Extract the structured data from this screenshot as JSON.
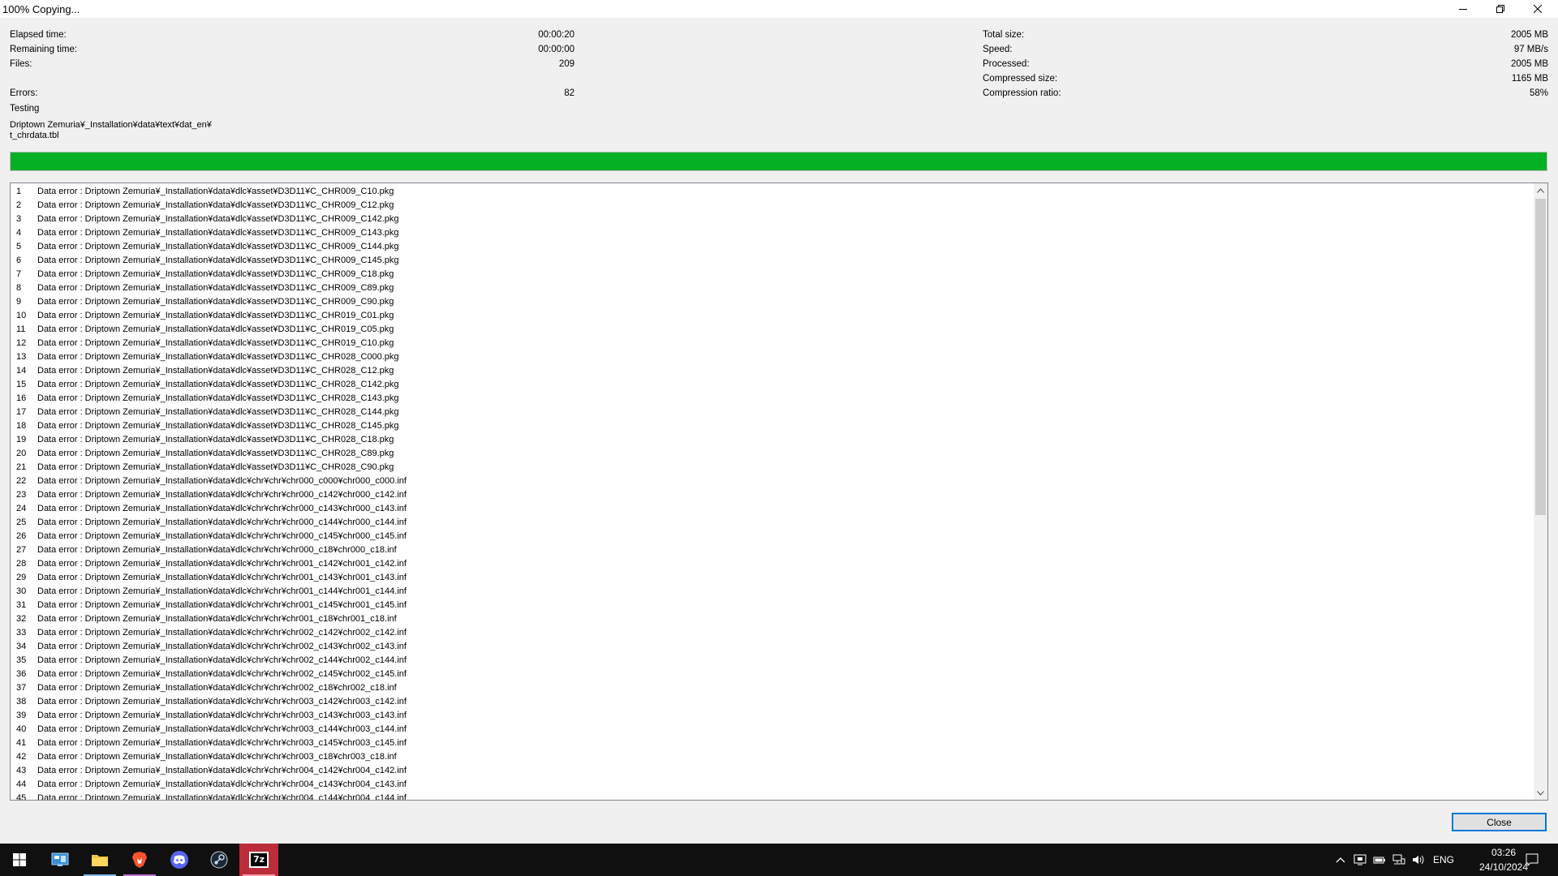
{
  "window": {
    "title": "100% Copying..."
  },
  "stats_left": [
    {
      "label": "Elapsed time:",
      "value": "00:00:20"
    },
    {
      "label": "Remaining time:",
      "value": "00:00:00"
    },
    {
      "label": "Files:",
      "value": "209"
    },
    {
      "label": "Errors:",
      "value": "82"
    }
  ],
  "stats_right": [
    {
      "label": "Total size:",
      "value": "2005 MB"
    },
    {
      "label": "Speed:",
      "value": "97 MB/s"
    },
    {
      "label": "Processed:",
      "value": "2005 MB"
    },
    {
      "label": "Compressed size:",
      "value": "1165 MB"
    },
    {
      "label": "Compression ratio:",
      "value": "58%"
    }
  ],
  "status_text": "Testing",
  "current_path_line1": "Driptown Zemuria¥_Installation¥data¥text¥dat_en¥",
  "current_path_line2": "t_chrdata.tbl",
  "progress": {
    "percent": 100,
    "color": "#06b025"
  },
  "log": [
    {
      "num": "1",
      "text": "Data error : Driptown Zemuria¥_Installation¥data¥dlc¥asset¥D3D11¥C_CHR009_C10.pkg"
    },
    {
      "num": "2",
      "text": "Data error : Driptown Zemuria¥_Installation¥data¥dlc¥asset¥D3D11¥C_CHR009_C12.pkg"
    },
    {
      "num": "3",
      "text": "Data error : Driptown Zemuria¥_Installation¥data¥dlc¥asset¥D3D11¥C_CHR009_C142.pkg"
    },
    {
      "num": "4",
      "text": "Data error : Driptown Zemuria¥_Installation¥data¥dlc¥asset¥D3D11¥C_CHR009_C143.pkg"
    },
    {
      "num": "5",
      "text": "Data error : Driptown Zemuria¥_Installation¥data¥dlc¥asset¥D3D11¥C_CHR009_C144.pkg"
    },
    {
      "num": "6",
      "text": "Data error : Driptown Zemuria¥_Installation¥data¥dlc¥asset¥D3D11¥C_CHR009_C145.pkg"
    },
    {
      "num": "7",
      "text": "Data error : Driptown Zemuria¥_Installation¥data¥dlc¥asset¥D3D11¥C_CHR009_C18.pkg"
    },
    {
      "num": "8",
      "text": "Data error : Driptown Zemuria¥_Installation¥data¥dlc¥asset¥D3D11¥C_CHR009_C89.pkg"
    },
    {
      "num": "9",
      "text": "Data error : Driptown Zemuria¥_Installation¥data¥dlc¥asset¥D3D11¥C_CHR009_C90.pkg"
    },
    {
      "num": "10",
      "text": "Data error : Driptown Zemuria¥_Installation¥data¥dlc¥asset¥D3D11¥C_CHR019_C01.pkg"
    },
    {
      "num": "11",
      "text": "Data error : Driptown Zemuria¥_Installation¥data¥dlc¥asset¥D3D11¥C_CHR019_C05.pkg"
    },
    {
      "num": "12",
      "text": "Data error : Driptown Zemuria¥_Installation¥data¥dlc¥asset¥D3D11¥C_CHR019_C10.pkg"
    },
    {
      "num": "13",
      "text": "Data error : Driptown Zemuria¥_Installation¥data¥dlc¥asset¥D3D11¥C_CHR028_C000.pkg"
    },
    {
      "num": "14",
      "text": "Data error : Driptown Zemuria¥_Installation¥data¥dlc¥asset¥D3D11¥C_CHR028_C12.pkg"
    },
    {
      "num": "15",
      "text": "Data error : Driptown Zemuria¥_Installation¥data¥dlc¥asset¥D3D11¥C_CHR028_C142.pkg"
    },
    {
      "num": "16",
      "text": "Data error : Driptown Zemuria¥_Installation¥data¥dlc¥asset¥D3D11¥C_CHR028_C143.pkg"
    },
    {
      "num": "17",
      "text": "Data error : Driptown Zemuria¥_Installation¥data¥dlc¥asset¥D3D11¥C_CHR028_C144.pkg"
    },
    {
      "num": "18",
      "text": "Data error : Driptown Zemuria¥_Installation¥data¥dlc¥asset¥D3D11¥C_CHR028_C145.pkg"
    },
    {
      "num": "19",
      "text": "Data error : Driptown Zemuria¥_Installation¥data¥dlc¥asset¥D3D11¥C_CHR028_C18.pkg"
    },
    {
      "num": "20",
      "text": "Data error : Driptown Zemuria¥_Installation¥data¥dlc¥asset¥D3D11¥C_CHR028_C89.pkg"
    },
    {
      "num": "21",
      "text": "Data error : Driptown Zemuria¥_Installation¥data¥dlc¥asset¥D3D11¥C_CHR028_C90.pkg"
    },
    {
      "num": "22",
      "text": "Data error : Driptown Zemuria¥_Installation¥data¥dlc¥chr¥chr¥chr000_c000¥chr000_c000.inf"
    },
    {
      "num": "23",
      "text": "Data error : Driptown Zemuria¥_Installation¥data¥dlc¥chr¥chr¥chr000_c142¥chr000_c142.inf"
    },
    {
      "num": "24",
      "text": "Data error : Driptown Zemuria¥_Installation¥data¥dlc¥chr¥chr¥chr000_c143¥chr000_c143.inf"
    },
    {
      "num": "25",
      "text": "Data error : Driptown Zemuria¥_Installation¥data¥dlc¥chr¥chr¥chr000_c144¥chr000_c144.inf"
    },
    {
      "num": "26",
      "text": "Data error : Driptown Zemuria¥_Installation¥data¥dlc¥chr¥chr¥chr000_c145¥chr000_c145.inf"
    },
    {
      "num": "27",
      "text": "Data error : Driptown Zemuria¥_Installation¥data¥dlc¥chr¥chr¥chr000_c18¥chr000_c18.inf"
    },
    {
      "num": "28",
      "text": "Data error : Driptown Zemuria¥_Installation¥data¥dlc¥chr¥chr¥chr001_c142¥chr001_c142.inf"
    },
    {
      "num": "29",
      "text": "Data error : Driptown Zemuria¥_Installation¥data¥dlc¥chr¥chr¥chr001_c143¥chr001_c143.inf"
    },
    {
      "num": "30",
      "text": "Data error : Driptown Zemuria¥_Installation¥data¥dlc¥chr¥chr¥chr001_c144¥chr001_c144.inf"
    },
    {
      "num": "31",
      "text": "Data error : Driptown Zemuria¥_Installation¥data¥dlc¥chr¥chr¥chr001_c145¥chr001_c145.inf"
    },
    {
      "num": "32",
      "text": "Data error : Driptown Zemuria¥_Installation¥data¥dlc¥chr¥chr¥chr001_c18¥chr001_c18.inf"
    },
    {
      "num": "33",
      "text": "Data error : Driptown Zemuria¥_Installation¥data¥dlc¥chr¥chr¥chr002_c142¥chr002_c142.inf"
    },
    {
      "num": "34",
      "text": "Data error : Driptown Zemuria¥_Installation¥data¥dlc¥chr¥chr¥chr002_c143¥chr002_c143.inf"
    },
    {
      "num": "35",
      "text": "Data error : Driptown Zemuria¥_Installation¥data¥dlc¥chr¥chr¥chr002_c144¥chr002_c144.inf"
    },
    {
      "num": "36",
      "text": "Data error : Driptown Zemuria¥_Installation¥data¥dlc¥chr¥chr¥chr002_c145¥chr002_c145.inf"
    },
    {
      "num": "37",
      "text": "Data error : Driptown Zemuria¥_Installation¥data¥dlc¥chr¥chr¥chr002_c18¥chr002_c18.inf"
    },
    {
      "num": "38",
      "text": "Data error : Driptown Zemuria¥_Installation¥data¥dlc¥chr¥chr¥chr003_c142¥chr003_c142.inf"
    },
    {
      "num": "39",
      "text": "Data error : Driptown Zemuria¥_Installation¥data¥dlc¥chr¥chr¥chr003_c143¥chr003_c143.inf"
    },
    {
      "num": "40",
      "text": "Data error : Driptown Zemuria¥_Installation¥data¥dlc¥chr¥chr¥chr003_c144¥chr003_c144.inf"
    },
    {
      "num": "41",
      "text": "Data error : Driptown Zemuria¥_Installation¥data¥dlc¥chr¥chr¥chr003_c145¥chr003_c145.inf"
    },
    {
      "num": "42",
      "text": "Data error : Driptown Zemuria¥_Installation¥data¥dlc¥chr¥chr¥chr003_c18¥chr003_c18.inf"
    },
    {
      "num": "43",
      "text": "Data error : Driptown Zemuria¥_Installation¥data¥dlc¥chr¥chr¥chr004_c142¥chr004_c142.inf"
    },
    {
      "num": "44",
      "text": "Data error : Driptown Zemuria¥_Installation¥data¥dlc¥chr¥chr¥chr004_c143¥chr004_c143.inf"
    },
    {
      "num": "45",
      "text": "Data error : Driptown Zemuria¥_Installation¥data¥dlc¥chr¥chr¥chr004_c144¥chr004_c144.inf"
    }
  ],
  "close_button": {
    "label": "Close"
  },
  "taskbar": {
    "apps": [
      {
        "name": "start-icon"
      },
      {
        "name": "control-panel-icon"
      },
      {
        "name": "file-explorer-icon"
      },
      {
        "name": "brave-browser-icon"
      },
      {
        "name": "discord-icon"
      },
      {
        "name": "steam-icon"
      },
      {
        "name": "7zip-icon",
        "label": "7z"
      }
    ],
    "language": "ENG",
    "time": "03:26",
    "date": "24/10/2024"
  }
}
